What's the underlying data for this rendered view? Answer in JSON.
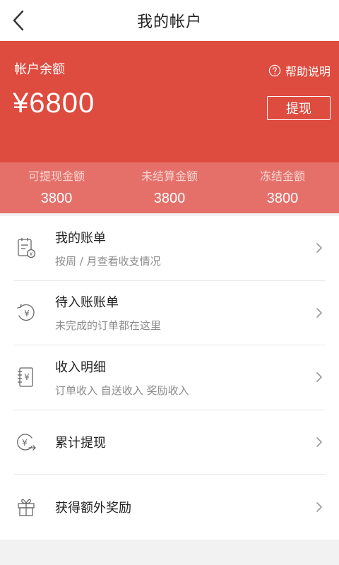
{
  "nav": {
    "title": "我的帐户",
    "back_icon": "chevron-left-icon"
  },
  "account": {
    "balance_label": "帐户余额",
    "help_label": "帮助说明",
    "balance_amount": "¥6800",
    "withdraw_label": "提现"
  },
  "stats": [
    {
      "label": "可提现金额",
      "value": "3800"
    },
    {
      "label": "未结算金额",
      "value": "3800"
    },
    {
      "label": "冻结金额",
      "value": "3800"
    }
  ],
  "menu": [
    {
      "title": "我的账单",
      "subtitle": "按周 / 月查看收支情况",
      "icon": "bill-icon"
    },
    {
      "title": "待入账账单",
      "subtitle": "未完成的订单都在这里",
      "icon": "pending-yuan-icon"
    },
    {
      "title": "收入明细",
      "subtitle": "订单收入 自送收入 奖励收入",
      "icon": "ledger-icon"
    },
    {
      "title": "累计提现",
      "icon": "withdraw-yuan-icon"
    },
    {
      "title": "获得额外奖励",
      "icon": "gift-icon"
    }
  ],
  "colors": {
    "accent": "#de4b3f",
    "stats_bg": "#e5706a"
  }
}
